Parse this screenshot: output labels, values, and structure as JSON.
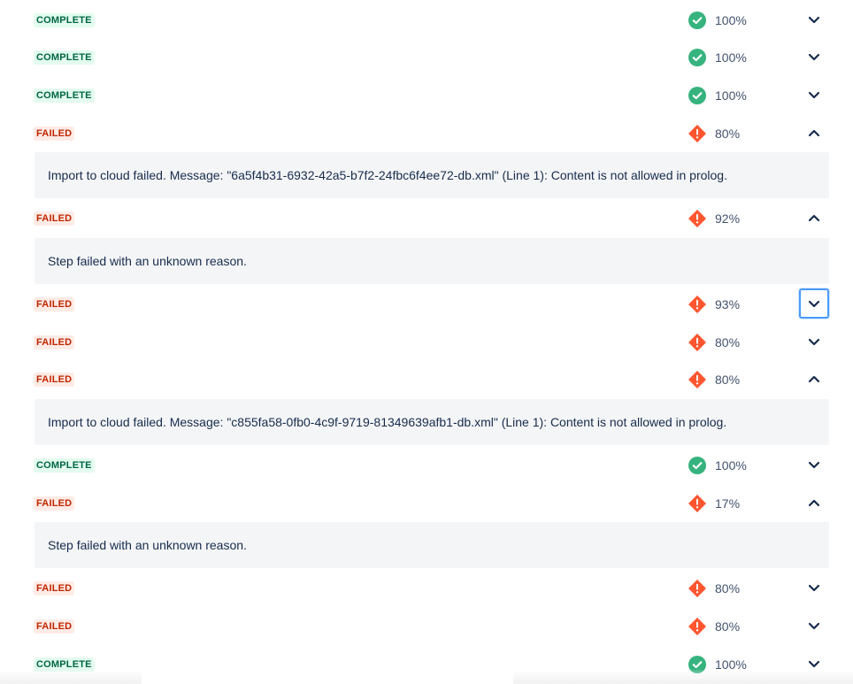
{
  "icons": {
    "complete": "check-circle-icon",
    "failed": "error-diamond-icon",
    "collapsed": "chevron-down-icon",
    "expanded": "chevron-up-icon"
  },
  "colors": {
    "complete_badge_bg": "#e3fcef",
    "complete_badge_text": "#006644",
    "failed_badge_bg": "#ffebe6",
    "failed_badge_text": "#bf2600",
    "success_icon": "#36b37e",
    "error_icon": "#ff5630",
    "detail_bg": "#f4f5f7",
    "focus_ring": "#4c9aff"
  },
  "steps": [
    {
      "status": "complete",
      "label": "COMPLETE",
      "percent": "100%",
      "expanded": false
    },
    {
      "status": "complete",
      "label": "COMPLETE",
      "percent": "100%",
      "expanded": false
    },
    {
      "status": "complete",
      "label": "COMPLETE",
      "percent": "100%",
      "expanded": false
    },
    {
      "status": "failed",
      "label": "FAILED",
      "percent": "80%",
      "expanded": true,
      "message": "Import to cloud failed. Message: \"6a5f4b31-6932-42a5-b7f2-24fbc6f4ee72-db.xml\" (Line 1): Content is not allowed in prolog."
    },
    {
      "status": "failed",
      "label": "FAILED",
      "percent": "92%",
      "expanded": true,
      "message": "Step failed with an unknown reason."
    },
    {
      "status": "failed",
      "label": "FAILED",
      "percent": "93%",
      "expanded": false,
      "focused": true
    },
    {
      "status": "failed",
      "label": "FAILED",
      "percent": "80%",
      "expanded": false
    },
    {
      "status": "failed",
      "label": "FAILED",
      "percent": "80%",
      "expanded": true,
      "message": "Import to cloud failed. Message: \"c855fa58-0fb0-4c9f-9719-81349639afb1-db.xml\" (Line 1): Content is not allowed in prolog."
    },
    {
      "status": "complete",
      "label": "COMPLETE",
      "percent": "100%",
      "expanded": false
    },
    {
      "status": "failed",
      "label": "FAILED",
      "percent": "17%",
      "expanded": true,
      "message": "Step failed with an unknown reason."
    },
    {
      "status": "failed",
      "label": "FAILED",
      "percent": "80%",
      "expanded": false
    },
    {
      "status": "failed",
      "label": "FAILED",
      "percent": "80%",
      "expanded": false
    },
    {
      "status": "complete",
      "label": "COMPLETE",
      "percent": "100%",
      "expanded": false
    }
  ]
}
